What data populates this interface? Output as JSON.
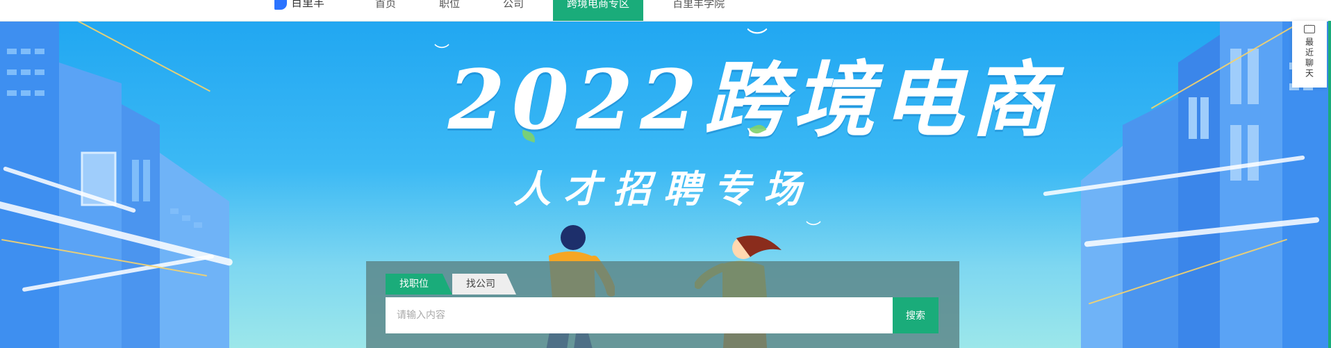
{
  "topbar": {
    "logo_text": "百里羊",
    "nav": [
      {
        "label": "首页"
      },
      {
        "label": "职位"
      },
      {
        "label": "公司"
      },
      {
        "label": "跨境电商专区",
        "active": true
      },
      {
        "label": "百里羊学院"
      }
    ]
  },
  "hero": {
    "title": "2022跨境电商",
    "subtitle": "人才招聘专场"
  },
  "search": {
    "tabs": [
      {
        "label": "找职位",
        "active": true
      },
      {
        "label": "找公司",
        "active": false
      }
    ],
    "placeholder": "请输入内容",
    "button_label": "搜索"
  },
  "chat_widget": {
    "label": "最近聊天"
  },
  "colors": {
    "accent": "#1aac7a",
    "sky_top": "#21a7f2",
    "sky_bottom": "#9ce7ea"
  }
}
